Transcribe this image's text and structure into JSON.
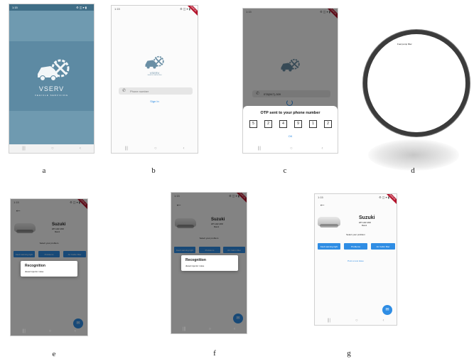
{
  "captions": {
    "a": "a",
    "b": "b",
    "c": "c",
    "d": "d",
    "e": "e",
    "f": "f",
    "g": "g"
  },
  "colors": {
    "splash_bg": "#6f9ab0",
    "accent": "#2f8de4",
    "debug_banner": "#b4112a",
    "scrim": "#3a3a3a"
  },
  "status_bar": {
    "time": "1:15",
    "icons": "⚙ ◫ ▾ ▮"
  },
  "debug_banner": "DEBUG",
  "nav_bar": {
    "icons": [
      "|||",
      "○",
      "‹"
    ]
  },
  "splash": {
    "app_name": "VSERV",
    "tagline": "VEHICLE SERVICING"
  },
  "login": {
    "app_name": "VSERV",
    "tagline": "VEHICLE SERVICING",
    "phone_placeholder": "Phone number",
    "sign_in": "Sign In",
    "phone_icon": "phone-icon"
  },
  "otp": {
    "phone_value": "078(947)-309",
    "title": "OTP sent to your phone number",
    "digits": [
      "5",
      "2",
      "4",
      "9",
      "1",
      "2"
    ],
    "ok": "OK"
  },
  "result": {
    "text": "Fuel pump filter"
  },
  "car": {
    "brand": "Suzuki",
    "plate": "WP CAW-4338",
    "model": "Maruti"
  },
  "problem": {
    "prompt": "Select your problem",
    "buttons": [
      "Fault warning light",
      "Problems",
      "Air Cabin filter"
    ],
    "link": "Post a new issue"
  },
  "recognition": {
    "title": "Recognition",
    "item": "diesel injector noise"
  },
  "fab_icon": "chat-icon"
}
